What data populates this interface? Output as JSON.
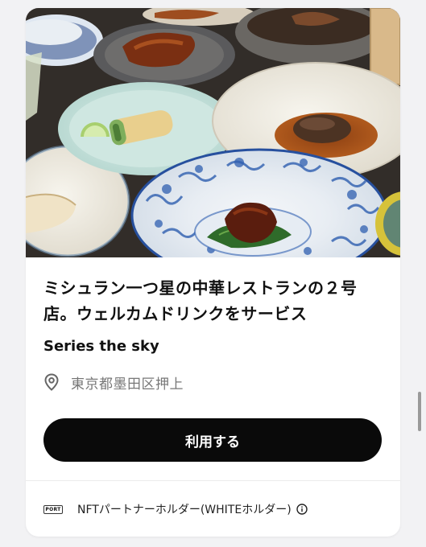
{
  "listing": {
    "title": "ミシュラン一つ星の中華レストランの２号店。ウェルカムドリンクをサービス",
    "series": "Series the sky",
    "location": "東京都墨田区押上",
    "icons": {
      "image": "restaurant-dishes-photo",
      "location": "map-pin-icon"
    }
  },
  "action": {
    "use_label": "利用する"
  },
  "footer": {
    "port_label": "PORT",
    "eligibility": "NFTパートナーホルダー(WHITEホルダー)",
    "icons": {
      "badge": "port-icon",
      "info": "info-icon"
    }
  },
  "colors": {
    "button_bg": "#0a0a0a",
    "button_text": "#ffffff",
    "muted_text": "#777777",
    "page_bg": "#f2f2f4"
  }
}
